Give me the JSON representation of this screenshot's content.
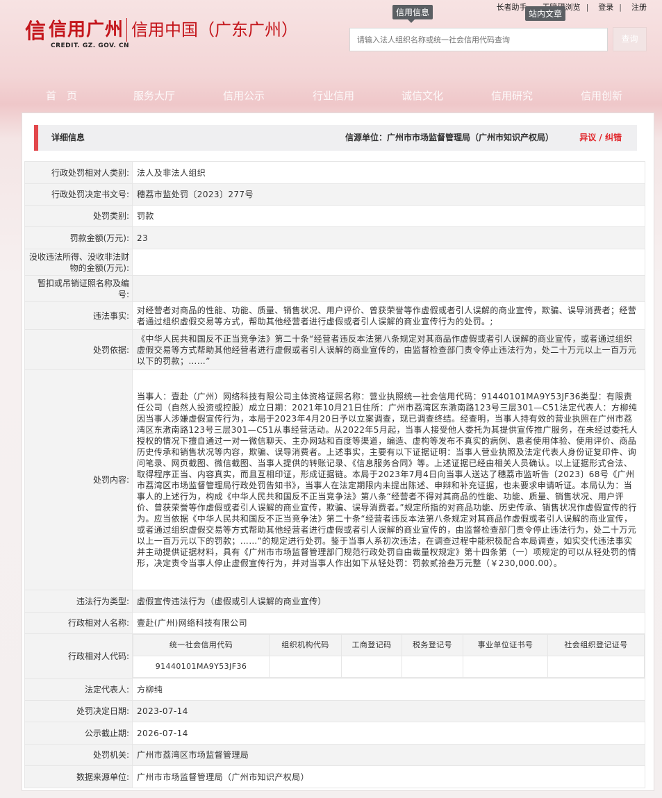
{
  "header": {
    "links": [
      "长者助手",
      "无障碍浏览",
      "登录",
      "注册"
    ],
    "tag_info": "信用信息",
    "tag_site": "站内文章",
    "logo_seal": "信",
    "logo_brand": "信用广州",
    "logo_url": "CREDIT. GZ. GOV. CN",
    "logo_sub": "信用中国（广东广州）",
    "search_placeholder": "请输入法人组织名称或统一社会信用代码查询",
    "search_button": "查询"
  },
  "nav": [
    "首　页",
    "服务大厅",
    "信用公示",
    "行业信用",
    "诚信文化",
    "信用研究",
    "信用创新"
  ],
  "detail": {
    "title": "详细信息",
    "source": "信源单位：广州市市场监督管理局（广州市知识产权局）",
    "objection": "异议 / 纠错"
  },
  "rows": [
    {
      "key": "行政处罚相对人类别:",
      "value": "法人及非法人组织"
    },
    {
      "key": "行政处罚决定书文号:",
      "value": "穗荔市监处罚〔2023〕277号"
    },
    {
      "key": "处罚类别:",
      "value": "罚款"
    },
    {
      "key": "罚款金额(万元):",
      "value": "23"
    },
    {
      "key": "没收违法所得、没收非法财物的金额(万元):",
      "value": ""
    },
    {
      "key": "暂扣或吊销证照名称及编号:",
      "value": ""
    },
    {
      "key": "违法事实:",
      "value": "对经营者对商品的性能、功能、质量、销售状况、用户评价、曾获荣誉等作虚假或者引人误解的商业宣传，欺骗、误导消费者；经营者通过组织虚假交易等方式，帮助其他经营者进行虚假或者引人误解的商业宣传行为的处罚。;"
    },
    {
      "key": "处罚依据:",
      "value": "《中华人民共和国反不正当竞争法》第二十条“经营者违反本法第八条规定对其商品作虚假或者引人误解的商业宣传，或者通过组织虚假交易等方式帮助其他经营者进行虚假或者引人误解的商业宣传的，由监督检查部门责令停止违法行为，处二十万元以上一百万元以下的罚款；……”"
    },
    {
      "key": "处罚内容:",
      "value": "当事人：壹赴（广州）网络科技有限公司主体资格证照名称：营业执照统一社会信用代码：91440101MA9Y53JF36类型：有限责任公司（自然人投资或控股）成立日期：2021年10月21日住所：广州市荔湾区东漖南路123号三层301—C51法定代表人：方柳纯因当事人涉嫌虚假宣传行为，本局于2023年4月20日予以立案调查，现已调查终结。经查明，当事人持有效的营业执照在广州市荔湾区东漖南路123号三层301—C51从事经营活动。从2022年5月起，当事人接受他人委托为其提供宣传推广服务，在未经过委托人授权的情况下擅自通过一对一微信聊天、主办网站和百度等渠道，编造、虚构等发布不真实的病例、患者使用体验、使用评价、商品历史传承和销售状况等内容，欺骗、误导消费者。上述事实，主要有以下证据证明：当事人营业执照及法定代表人身份证复印件、询问笔录、网页截图、微信截图、当事人提供的转账记录、《信息服务合同》等。上述证据已经由相关人员确认。以上证据形式合法、取得程序正当、内容真实，而且互相印证，形成证据链。本局于2023年7月4日向当事人送达了穗荔市监听告〔2023〕68号《广州市荔湾区市场监督管理局行政处罚告知书》，当事人在法定期限内未提出陈述、申辩和补充证据，也未要求申请听证。本局认为：当事人的上述行为，构成《中华人民共和国反不正当竞争法》第八条“经营者不得对其商品的性能、功能、质量、销售状况、用户评价、曾获荣誉等作虚假或者引人误解的商业宣传，欺骗、误导消费者。”规定所指的对商品功能、历史传承、销售状况作虚假宣传的行为。应当依据《中华人民共和国反不正当竞争法》第二十条“经营者违反本法第八条规定对其商品作虚假或者引人误解的商业宣传，或者通过组织虚假交易等方式帮助其他经营者进行虚假或者引人误解的商业宣传的，由监督检查部门责令停止违法行为，处二十万元以上一百万元以下的罚款；……”的规定进行处罚。鉴于当事人系初次违法，在调查过程中能积极配合本局调查，如实交代违法事实并主动提供证据材料，具有《广州市市场监督管理部门规范行政处罚自由裁量权规定》第十四条第（一）项规定的可以从轻处罚的情形，决定责令当事人停止虚假宣传行为，并对当事人作出如下从轻处罚：罚款贰拾叁万元整（￥230,000.00）。"
    },
    {
      "key": "违法行为类型:",
      "value": "虚假宣传违法行为（虚假或引人误解的商业宣传）"
    },
    {
      "key": "行政相对人名称:",
      "value": "壹赴(广州)网络科技有限公司"
    }
  ],
  "code_row": {
    "key": "行政相对人代码:",
    "headers": [
      "统一社会信用代码",
      "组织机构代码",
      "工商登记码",
      "税务登记号",
      "事业单位证书号",
      "社会组织登记证号"
    ],
    "values": [
      "91440101MA9Y53JF36",
      "",
      "",
      "",
      "",
      ""
    ]
  },
  "tail_rows": [
    {
      "key": "法定代表人:",
      "value": "方柳纯"
    },
    {
      "key": "处罚决定日期:",
      "value": "2023-07-14"
    },
    {
      "key": "公示截止期:",
      "value": "2026-07-14"
    },
    {
      "key": "处罚机关:",
      "value": "广州市荔湾区市场监督管理局"
    },
    {
      "key": "数据来源单位:",
      "value": "广州市市场监督管理局（广州市知识产权局）"
    }
  ]
}
